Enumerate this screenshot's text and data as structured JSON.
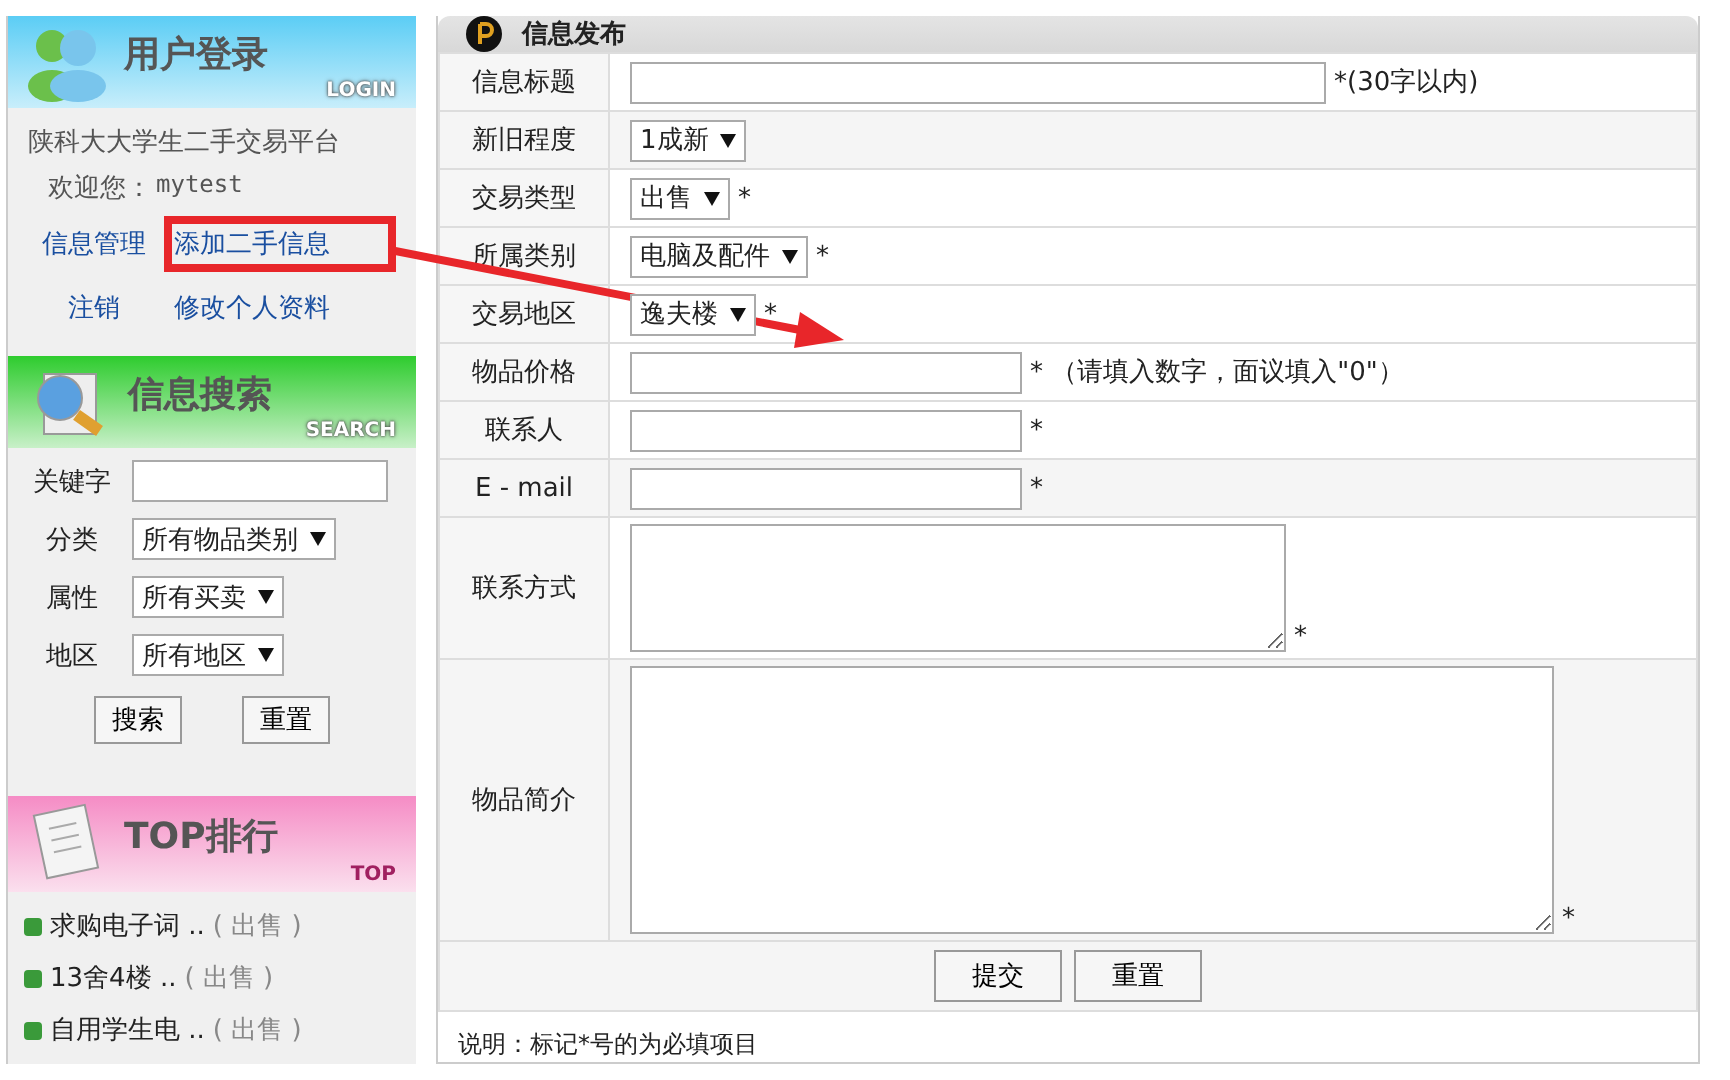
{
  "sidebar": {
    "login": {
      "title": "用户登录",
      "subtitle": "LOGIN",
      "site_name": "陕科大大学生二手交易平台",
      "welcome_label": "欢迎您：",
      "username": "mytest",
      "links": [
        {
          "label": "信息管理",
          "highlighted": false
        },
        {
          "label": "添加二手信息",
          "highlighted": true
        },
        {
          "label": "注销",
          "highlighted": false
        },
        {
          "label": "修改个人资料",
          "highlighted": false
        }
      ]
    },
    "search": {
      "title": "信息搜索",
      "subtitle": "SEARCH",
      "fields": [
        {
          "label": "关键字",
          "kind": "text"
        },
        {
          "label": "分类",
          "kind": "select",
          "value": "所有物品类别"
        },
        {
          "label": "属性",
          "kind": "select",
          "value": "所有买卖"
        },
        {
          "label": "地区",
          "kind": "select",
          "value": "所有地区"
        }
      ],
      "buttons": [
        "搜索",
        "重置"
      ]
    },
    "top": {
      "title": "TOP排行",
      "subtitle": "TOP",
      "items": [
        {
          "title": "求购电子词 ..",
          "tag": "( 出售 )"
        },
        {
          "title": "13舍4楼 ..",
          "tag": "( 出售 )"
        },
        {
          "title": "自用学生电 ..",
          "tag": "( 出售 )"
        }
      ]
    }
  },
  "form": {
    "title": "信息发布",
    "rows": [
      {
        "label": "信息标题",
        "kind": "text",
        "hint": "*(30字以内)"
      },
      {
        "label": "新旧程度",
        "kind": "select",
        "value": "1成新"
      },
      {
        "label": "交易类型",
        "kind": "select",
        "value": "出售",
        "hint": "*"
      },
      {
        "label": "所属类别",
        "kind": "select",
        "value": "电脑及配件",
        "hint": "*"
      },
      {
        "label": "交易地区",
        "kind": "select",
        "value": "逸夫楼",
        "hint": "*"
      },
      {
        "label": "物品价格",
        "kind": "text",
        "hint": "* （请填入数字，面议填入\"0\"）"
      },
      {
        "label": "联系人",
        "kind": "text",
        "hint": "*"
      },
      {
        "label": "E - mail",
        "kind": "text",
        "hint": "*"
      },
      {
        "label": "联系方式",
        "kind": "textarea",
        "hint": "*"
      },
      {
        "label": "物品简介",
        "kind": "textarea",
        "hint": "*"
      }
    ],
    "buttons": [
      "提交",
      "重置"
    ],
    "note": "说明：标记*号的为必填项目"
  },
  "annotation_arrow": true
}
